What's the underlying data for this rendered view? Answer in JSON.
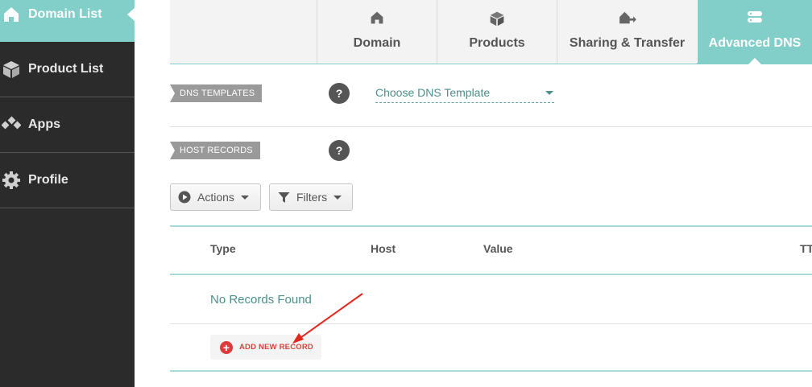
{
  "sidebar": {
    "items": [
      {
        "label": "Domain List",
        "icon": "home-icon"
      },
      {
        "label": "Product List",
        "icon": "box-icon"
      },
      {
        "label": "Apps",
        "icon": "apps-icon"
      },
      {
        "label": "Profile",
        "icon": "gear-icon"
      }
    ]
  },
  "tabs": [
    {
      "label": "Domain",
      "icon": "home-icon"
    },
    {
      "label": "Products",
      "icon": "box-icon"
    },
    {
      "label": "Sharing & Transfer",
      "icon": "transfer-icon"
    },
    {
      "label": "Advanced DNS",
      "icon": "dns-server-icon"
    }
  ],
  "dns_templates": {
    "label": "DNS TEMPLATES",
    "help": "?",
    "select_value": "Choose DNS Template"
  },
  "host_records": {
    "label": "HOST RECORDS",
    "help": "?"
  },
  "toolbar": {
    "actions_label": "Actions",
    "filters_label": "Filters"
  },
  "table": {
    "columns": [
      "Type",
      "Host",
      "Value",
      "TTL"
    ],
    "empty_message": "No Records Found",
    "add_label": "ADD NEW RECORD"
  },
  "colors": {
    "accent": "#82cfc9",
    "sidebar_bg": "#2b2b2b",
    "add_red": "#e03b3b"
  }
}
